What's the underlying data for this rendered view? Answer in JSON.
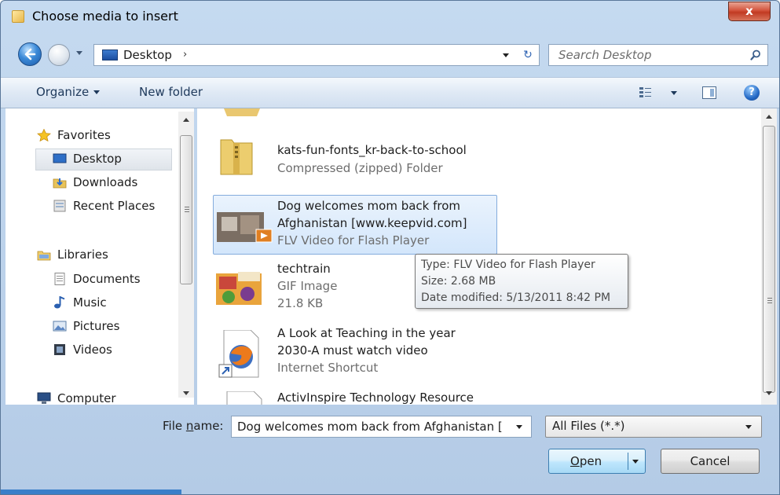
{
  "window": {
    "title": "Choose media to insert",
    "close_glyph": "x"
  },
  "address": {
    "location": "Desktop",
    "separator": "›",
    "refresh_glyph": "↻"
  },
  "search": {
    "placeholder": "Search Desktop"
  },
  "toolbar": {
    "organize_label": "Organize",
    "new_folder_label": "New folder",
    "help_glyph": "?"
  },
  "nav": {
    "favorites": {
      "label": "Favorites",
      "icon": "star-icon"
    },
    "favorites_items": [
      {
        "label": "Desktop",
        "icon": "desktop-icon",
        "selected": true
      },
      {
        "label": "Downloads",
        "icon": "downloads-icon"
      },
      {
        "label": "Recent Places",
        "icon": "recent-places-icon"
      }
    ],
    "libraries": {
      "label": "Libraries",
      "icon": "libraries-icon"
    },
    "libraries_items": [
      {
        "label": "Documents",
        "icon": "documents-icon"
      },
      {
        "label": "Music",
        "icon": "music-icon"
      },
      {
        "label": "Pictures",
        "icon": "pictures-icon"
      },
      {
        "label": "Videos",
        "icon": "videos-icon"
      }
    ],
    "computer": {
      "label": "Computer",
      "icon": "computer-icon"
    }
  },
  "files": [
    {
      "name": "kats-fun-fonts_kr-back-to-school",
      "type": "Compressed (zipped) Folder",
      "icon": "zip-folder-icon"
    },
    {
      "name_line1": "Dog welcomes mom back from",
      "name_line2": "Afghanistan [www.keepvid.com]",
      "type": "FLV Video for Flash Player",
      "icon": "video-thumbnail-icon",
      "selected": true
    },
    {
      "name": "techtrain",
      "type": "GIF Image",
      "size": "21.8 KB",
      "icon": "gif-thumbnail-icon"
    },
    {
      "name_line1": "A Look at Teaching in the year",
      "name_line2": "2030-A must watch video",
      "type": "Internet Shortcut",
      "icon": "firefox-shortcut-icon"
    },
    {
      "name": "ActivInspire Technology Resource",
      "icon": "document-icon"
    }
  ],
  "tooltip": {
    "type": "Type: FLV Video for Flash Player",
    "size": "Size: 2.68 MB",
    "modified": "Date modified: 5/13/2011 8:42 PM"
  },
  "bottom": {
    "file_name_label_pre": "File ",
    "file_name_label_accel": "n",
    "file_name_label_post": "ame:",
    "file_name_value": "Dog welcomes mom back from Afghanistan [",
    "file_type_value": "All Files (*.*)",
    "open_accel": "O",
    "open_rest": "pen",
    "cancel_label": "Cancel"
  },
  "colors": {
    "selection_bg": "#d3e6fb",
    "selection_border": "#84acdd",
    "chrome": "#c5daf0"
  }
}
